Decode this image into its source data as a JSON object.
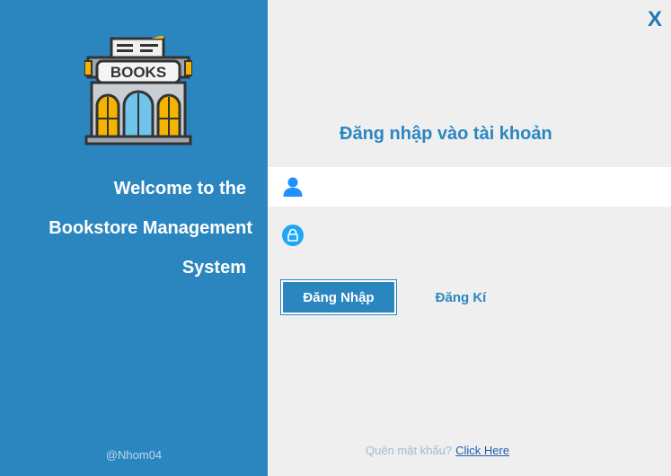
{
  "left": {
    "welcome_line1": "Welcome to the",
    "welcome_line2": "Bookstore Management",
    "welcome_line3": "System",
    "credit": "@Nhom04",
    "logo_text": "BOOKS"
  },
  "right": {
    "close_label": "X",
    "title": "Đăng nhập vào tài khoản",
    "username": {
      "value": "",
      "placeholder": ""
    },
    "password": {
      "value": "",
      "placeholder": ""
    },
    "login_label": "Đăng Nhập",
    "register_label": "Đăng Kí",
    "forgot_text": "Quên mật khẩu?",
    "forgot_link": "Click Here"
  },
  "icons": {
    "user": "user-icon",
    "lock": "lock-icon",
    "logo": "bookstore-logo"
  },
  "colors": {
    "left_bg": "#2b86c0",
    "right_bg": "#efefef",
    "accent": "#2b86c0",
    "link": "#1f5fa8"
  }
}
